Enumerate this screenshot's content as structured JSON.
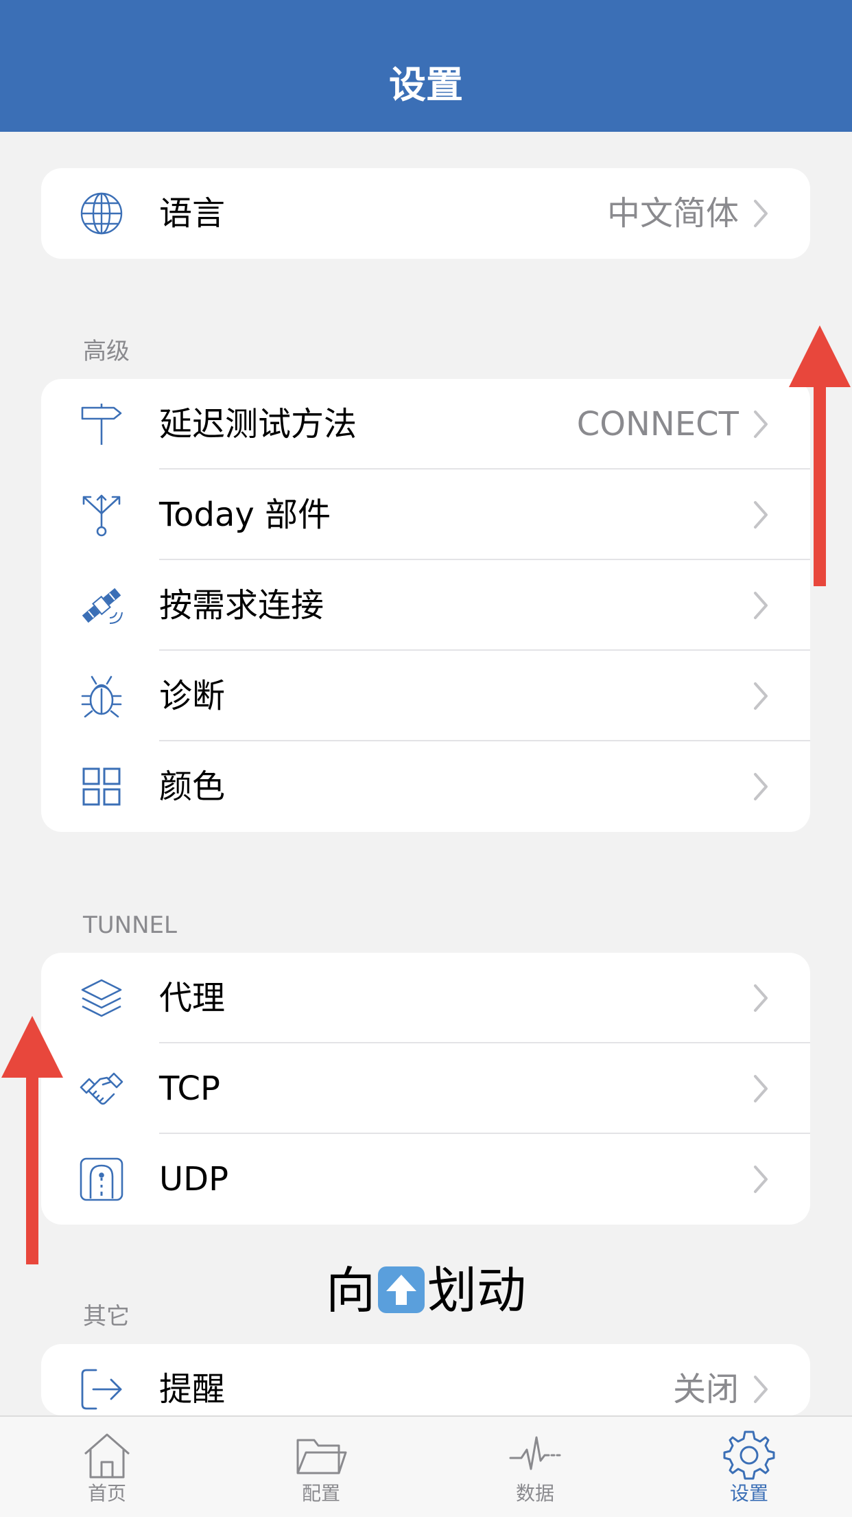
{
  "nav": {
    "title": "设置"
  },
  "language_card": {
    "label": "语言",
    "value": "中文简体"
  },
  "advanced": {
    "header": "高级",
    "items": [
      {
        "label": "延迟测试方法",
        "value": "CONNECT"
      },
      {
        "label": "Today 部件",
        "value": ""
      },
      {
        "label": "按需求连接",
        "value": ""
      },
      {
        "label": "诊断",
        "value": ""
      },
      {
        "label": "颜色",
        "value": ""
      }
    ]
  },
  "tunnel": {
    "header": "TUNNEL",
    "items": [
      {
        "label": "代理",
        "value": ""
      },
      {
        "label": "TCP",
        "value": ""
      },
      {
        "label": "UDP",
        "value": ""
      }
    ]
  },
  "other": {
    "header": "其它",
    "items": [
      {
        "label": "提醒",
        "value": "关闭"
      }
    ]
  },
  "overlay": {
    "before": "向",
    "after": "划动",
    "emoji": "up-arrow-emoji"
  },
  "tabs": [
    {
      "label": "首页",
      "icon": "home-icon"
    },
    {
      "label": "配置",
      "icon": "folder-icon"
    },
    {
      "label": "数据",
      "icon": "pulse-icon"
    },
    {
      "label": "设置",
      "icon": "gear-icon"
    }
  ],
  "colors": {
    "accent": "#3b6fb6",
    "annotation_arrow": "#e8473c",
    "background": "#f2f2f2"
  }
}
